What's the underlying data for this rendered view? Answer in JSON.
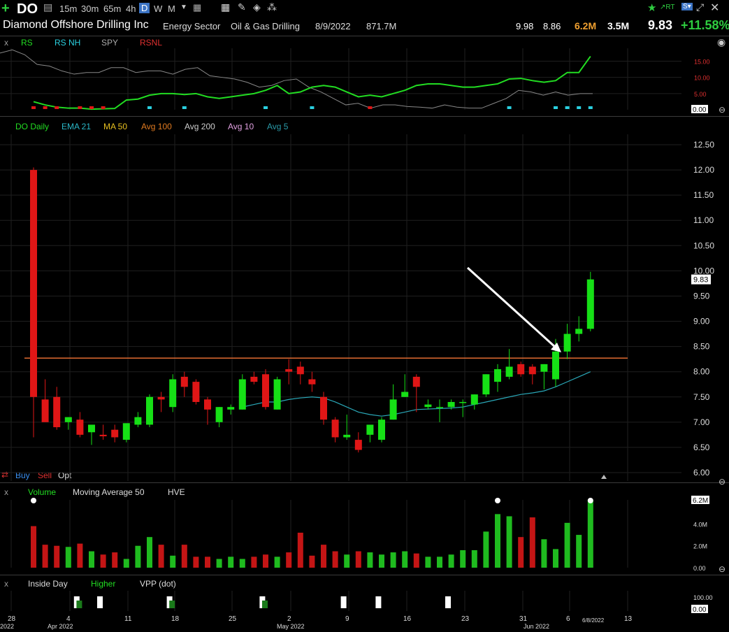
{
  "colors": {
    "up": "#16e016",
    "down": "#e01616",
    "ema21": "#2aa8b8",
    "resist": "#e06a30",
    "rs": "#22dd22",
    "spy": "#888888",
    "grid": "#1f1f1f"
  },
  "toolbar": {
    "plus_icon": "plus-icon",
    "symbol": "DO",
    "timeframes": [
      "15m",
      "30m",
      "65m",
      "4h",
      "D",
      "W",
      "M"
    ],
    "active_timeframe": "D"
  },
  "header": {
    "company": "Diamond Offshore Drilling Inc",
    "sector": "Energy Sector",
    "industry": "Oil & Gas Drilling",
    "date": "8/9/2022",
    "mcap": "871.7M",
    "v1": "9.98",
    "v2": "8.86",
    "vol": "6.2M",
    "avgvol": "3.5M",
    "last": "9.83",
    "change": "+11.58%"
  },
  "rs_panel": {
    "close": "x",
    "items": [
      "RS",
      "RS NH",
      "SPY",
      "RSNL"
    ],
    "yticks": [
      "15.00",
      "10.00",
      "5.00"
    ],
    "last": "0.00"
  },
  "price_panel": {
    "items": [
      "DO Daily",
      "EMA 21",
      "MA 50",
      "Avg 100",
      "Avg 200",
      "Avg 10",
      "Avg 5"
    ],
    "item_colors": [
      "#22dd22",
      "#2aa8b8",
      "#e8c020",
      "#e07a20",
      "#cccccc",
      "#e0a0e0",
      "#2aa8b8"
    ],
    "buy": "Buy",
    "sell": "Sell",
    "opt": "Opt",
    "last_price": "9.83"
  },
  "volume_panel": {
    "close": "x",
    "items": [
      "Volume",
      "Moving Average 50",
      "HVE"
    ],
    "yticks": [
      "4.0M",
      "2.0M",
      "0.00"
    ],
    "last": "6.2M"
  },
  "inside_panel": {
    "close": "x",
    "items": [
      "Inside Day",
      "Higher",
      "VPP (dot)"
    ],
    "yticks": [
      "100.00",
      "0.00"
    ]
  },
  "xaxis": {
    "ticks": [
      "28",
      "4",
      "11",
      "18",
      "25",
      "2",
      "9",
      "16",
      "23",
      "31",
      "6",
      "13"
    ],
    "months": [
      "2022",
      "Apr 2022",
      "May 2022",
      "Jun 2022"
    ],
    "cursor_date": "6/8/2022"
  },
  "chart_data": {
    "type": "candlestick",
    "title": "DO Daily",
    "ylim": [
      6.0,
      12.5
    ],
    "yticks": [
      6.0,
      6.5,
      7.0,
      7.5,
      8.0,
      8.5,
      9.0,
      9.5,
      10.0,
      10.5,
      11.0,
      11.5,
      12.0,
      12.5
    ],
    "resistance": 8.27,
    "dates": [
      "3/30",
      "3/31",
      "4/1",
      "4/4",
      "4/5",
      "4/6",
      "4/7",
      "4/8",
      "4/11",
      "4/12",
      "4/13",
      "4/14",
      "4/18",
      "4/19",
      "4/20",
      "4/21",
      "4/22",
      "4/25",
      "4/26",
      "4/27",
      "4/28",
      "4/29",
      "5/2",
      "5/3",
      "5/4",
      "5/5",
      "5/6",
      "5/9",
      "5/10",
      "5/11",
      "5/12",
      "5/13",
      "5/16",
      "5/17",
      "5/18",
      "5/19",
      "5/20",
      "5/23",
      "5/24",
      "5/25",
      "5/26",
      "5/27",
      "5/31",
      "6/1",
      "6/2",
      "6/3",
      "6/6",
      "6/7",
      "6/8"
    ],
    "open": [
      12.0,
      7.45,
      7.5,
      7.0,
      7.05,
      6.8,
      6.75,
      6.85,
      6.65,
      6.95,
      6.95,
      7.5,
      7.3,
      7.9,
      7.8,
      7.45,
      7.0,
      7.25,
      7.25,
      7.9,
      7.95,
      7.25,
      8.05,
      8.1,
      7.85,
      7.5,
      7.05,
      6.7,
      6.65,
      6.75,
      6.65,
      7.05,
      7.5,
      7.9,
      7.3,
      7.3,
      7.3,
      7.4,
      7.35,
      7.55,
      7.8,
      7.9,
      8.15,
      8.1,
      8.0,
      7.85,
      8.4,
      8.75,
      8.85
    ],
    "high": [
      12.05,
      7.85,
      7.7,
      7.1,
      7.2,
      6.95,
      6.95,
      6.95,
      6.95,
      7.2,
      7.55,
      7.6,
      7.95,
      8.0,
      7.85,
      7.5,
      7.3,
      7.35,
      7.95,
      8.0,
      8.05,
      7.9,
      8.25,
      8.2,
      8.0,
      7.6,
      7.1,
      7.15,
      6.8,
      6.85,
      7.1,
      7.75,
      7.95,
      7.95,
      7.45,
      7.45,
      7.45,
      7.45,
      7.55,
      7.95,
      8.15,
      8.45,
      8.2,
      8.15,
      8.15,
      8.65,
      8.95,
      9.1,
      9.98
    ],
    "low": [
      6.7,
      7.2,
      6.85,
      6.85,
      6.7,
      6.55,
      6.65,
      6.6,
      6.6,
      6.9,
      6.9,
      7.2,
      7.2,
      7.5,
      7.35,
      6.95,
      6.9,
      7.15,
      7.25,
      7.75,
      7.25,
      7.25,
      7.75,
      7.75,
      7.6,
      6.95,
      6.6,
      6.65,
      6.4,
      6.6,
      6.6,
      7.05,
      7.5,
      7.2,
      7.25,
      7.0,
      7.25,
      7.1,
      7.25,
      7.5,
      7.6,
      7.85,
      7.9,
      7.75,
      7.65,
      7.7,
      8.25,
      8.6,
      8.8
    ],
    "close": [
      7.5,
      7.0,
      6.9,
      7.1,
      6.75,
      6.95,
      6.72,
      6.7,
      6.98,
      7.1,
      7.5,
      7.45,
      7.85,
      7.7,
      7.4,
      7.25,
      7.3,
      7.3,
      7.85,
      7.8,
      7.3,
      7.85,
      8.0,
      7.95,
      7.75,
      7.05,
      6.7,
      6.75,
      6.45,
      6.95,
      7.05,
      7.45,
      7.6,
      7.7,
      7.35,
      7.3,
      7.4,
      7.4,
      7.55,
      7.95,
      8.05,
      8.1,
      7.95,
      7.95,
      8.15,
      8.4,
      8.75,
      8.85,
      9.83
    ],
    "ema21": [
      null,
      null,
      null,
      null,
      null,
      null,
      null,
      null,
      null,
      null,
      null,
      null,
      null,
      null,
      null,
      null,
      null,
      null,
      7.3,
      7.35,
      7.4,
      7.4,
      7.45,
      7.48,
      7.5,
      7.48,
      7.4,
      7.3,
      7.2,
      7.15,
      7.12,
      7.15,
      7.2,
      7.25,
      7.26,
      7.27,
      7.28,
      7.3,
      7.35,
      7.4,
      7.45,
      7.5,
      7.55,
      7.58,
      7.62,
      7.7,
      7.8,
      7.9,
      8.0
    ],
    "volume_m": [
      3.8,
      2.1,
      2.0,
      1.9,
      2.2,
      1.5,
      1.2,
      1.4,
      0.8,
      2.0,
      2.8,
      2.1,
      1.1,
      2.1,
      1.0,
      1.0,
      0.8,
      1.0,
      0.8,
      1.0,
      1.2,
      1.0,
      1.4,
      3.2,
      1.1,
      2.1,
      1.5,
      1.2,
      1.5,
      1.4,
      1.2,
      1.4,
      1.5,
      1.3,
      1.0,
      1.0,
      1.2,
      1.6,
      1.6,
      3.3,
      4.9,
      4.7,
      2.8,
      4.6,
      2.6,
      1.7,
      4.1,
      3.0,
      6.2
    ],
    "rs_line": [
      2.5,
      1.5,
      0.8,
      0.5,
      0.5,
      0.2,
      0.3,
      0.4,
      3.0,
      3.3,
      4.5,
      5.0,
      5.0,
      4.7,
      5.0,
      4.0,
      3.5,
      4.0,
      4.5,
      5.0,
      6.0,
      7.5,
      5.0,
      5.5,
      7.0,
      7.5,
      7.0,
      5.5,
      4.0,
      4.5,
      4.0,
      5.0,
      6.0,
      7.5,
      8.0,
      8.0,
      7.5,
      7.0,
      7.0,
      7.5,
      8.0,
      9.5,
      9.7,
      9.0,
      8.5,
      9.0,
      11.5,
      11.5,
      16.5
    ],
    "spy_line": [
      17.5,
      18.5,
      17.0,
      14.0,
      13.5,
      12.0,
      11.0,
      11.5,
      11.5,
      13.0,
      13.0,
      11.5,
      12.0,
      12.0,
      11.0,
      12.5,
      13.0,
      10.5,
      10.0,
      9.5,
      8.5,
      7.0,
      7.5,
      9.0,
      9.5,
      7.0,
      5.5,
      3.5,
      1.5,
      2.0,
      0.5,
      1.5,
      1.5,
      1.0,
      0.8,
      0.5,
      1.5,
      0.8,
      0.5,
      0.5,
      2.0,
      3.5,
      6.0,
      5.5,
      4.5,
      5.5,
      4.5,
      5.0,
      5.0
    ]
  }
}
